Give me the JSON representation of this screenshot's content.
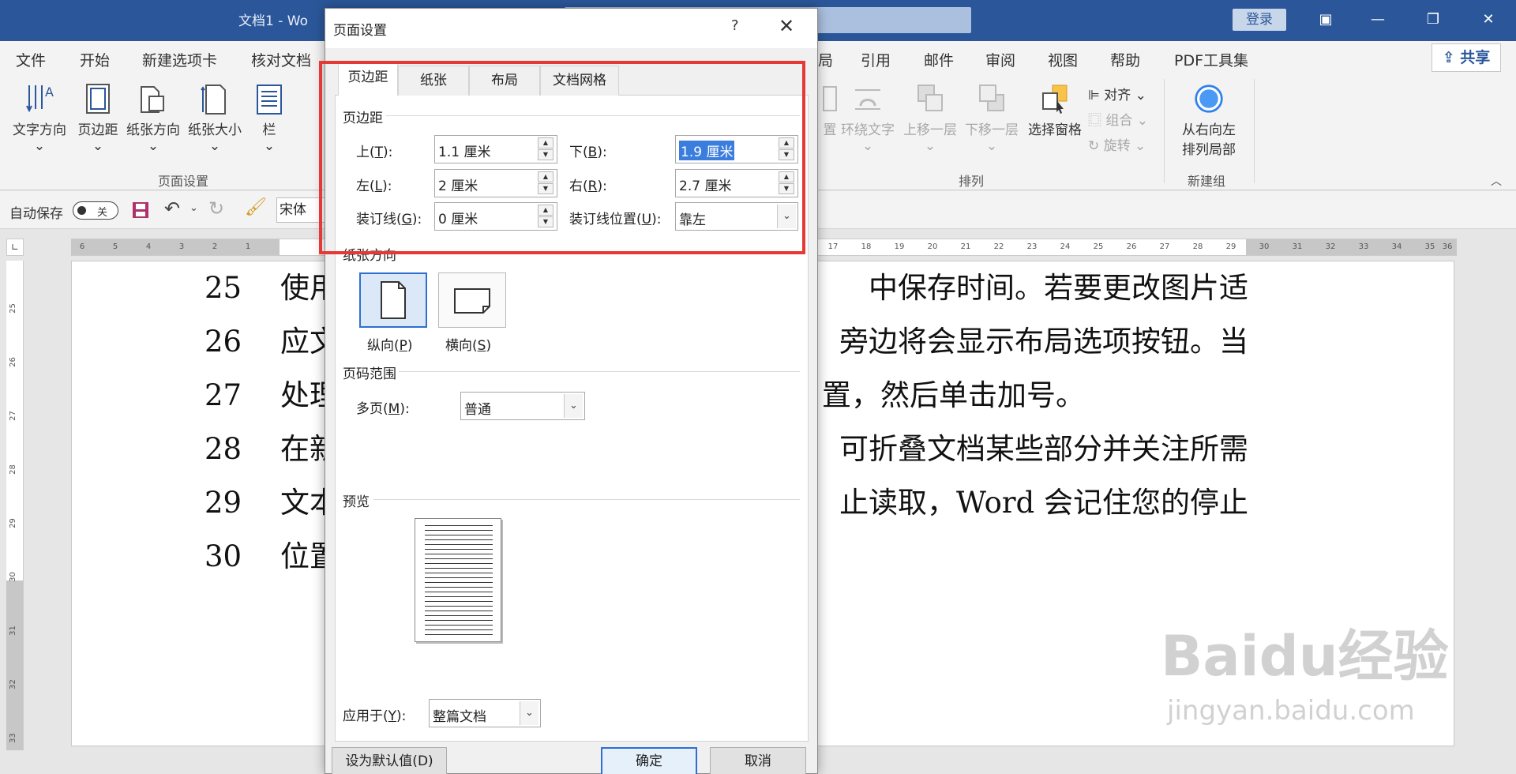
{
  "window": {
    "doc_title": "文档1 - Wo",
    "login_label": "登录"
  },
  "ribbon_tabs": [
    "文件",
    "开始",
    "新建选项卡",
    "核对文档",
    "局",
    "引用",
    "邮件",
    "审阅",
    "视图",
    "帮助",
    "PDF工具集"
  ],
  "share_label": "共享",
  "ribbon": {
    "page_setup": {
      "text_direction": "文字方向",
      "margins": "页边距",
      "orientation": "纸张方向",
      "size": "纸张大小",
      "columns": "栏",
      "group_label": "页面设置"
    },
    "arrange": {
      "position": "置",
      "wrap_text": "环绕文字",
      "bring_forward": "上移一层",
      "send_backward": "下移一层",
      "selection_pane": "选择窗格",
      "align": "对齐",
      "group": "组合",
      "rotate": "旋转",
      "group_label": "排列"
    },
    "new_group": {
      "rtl_layout_line1": "从右向左",
      "rtl_layout_line2": "排列局部",
      "group_label": "新建组"
    }
  },
  "qat": {
    "autosave_label": "自动保存",
    "autosave_state": "关",
    "font_name": "宋体"
  },
  "ruler": {
    "left_numbers": [
      "6",
      "5",
      "4",
      "3",
      "2",
      "1"
    ],
    "right_numbers": [
      "17",
      "18",
      "19",
      "20",
      "21",
      "22",
      "23",
      "24",
      "25",
      "26",
      "27",
      "28",
      "29",
      "30",
      "31",
      "32",
      "33",
      "34",
      "35",
      "36"
    ],
    "vertical_numbers": [
      "25",
      "26",
      "27",
      "28",
      "29",
      "30",
      "31",
      "32",
      "33"
    ]
  },
  "document": {
    "lines": [
      {
        "num": "25",
        "left": "使用",
        "right": "中保存时间。若要更改图片适"
      },
      {
        "num": "26",
        "left": "应文",
        "right": "旁边将会显示布局选项按钮。当"
      },
      {
        "num": "27",
        "left": "处理",
        "right": "置，然后单击加号。"
      },
      {
        "num": "28",
        "left": "在新",
        "right": "可折叠文档某些部分并关注所需"
      },
      {
        "num": "29",
        "left": "文本",
        "right": "止读取，Word 会记住您的停止"
      },
      {
        "num": "30",
        "left": "位置",
        "right": ""
      }
    ],
    "watermark": "Baidu经验",
    "watermark_sub": "jingyan.baidu.com"
  },
  "dialog": {
    "title": "页面设置",
    "help": "?",
    "tabs": [
      "页边距",
      "纸张",
      "布局",
      "文档网格"
    ],
    "margins_section": "页边距",
    "top_label": "上(",
    "top_key": "T",
    "top_end": "):",
    "top_value": "1.1 厘米",
    "bottom_label": "下(",
    "bottom_key": "B",
    "bottom_end": "):",
    "bottom_value": "1.9 厘米",
    "left_label": "左(",
    "left_key": "L",
    "left_end": "):",
    "left_value": "2 厘米",
    "right_label": "右(",
    "right_key": "R",
    "right_end": "):",
    "right_value": "2.7 厘米",
    "gutter_label": "装订线(",
    "gutter_key": "G",
    "gutter_end": "):",
    "gutter_value": "0 厘米",
    "gutter_pos_label": "装订线位置(",
    "gutter_pos_key": "U",
    "gutter_pos_end": "):",
    "gutter_pos_value": "靠左",
    "orientation_section": "纸张方向",
    "portrait_label": "纵向(",
    "portrait_key": "P",
    "portrait_end": ")",
    "landscape_label": "横向(",
    "landscape_key": "S",
    "landscape_end": ")",
    "pages_section": "页码范围",
    "multiple_pages_label": "多页(",
    "multiple_pages_key": "M",
    "multiple_pages_end": "):",
    "multiple_pages_value": "普通",
    "preview_section": "预览",
    "apply_to_label": "应用于(",
    "apply_to_key": "Y",
    "apply_to_end": "):",
    "apply_to_value": "整篇文档",
    "default_btn": "设为默认值(D)",
    "ok_btn": "确定",
    "cancel_btn": "取消"
  },
  "colors": {
    "title_bar": "#2b579a",
    "highlight": "#e53935",
    "selection": "#3b7ddd"
  }
}
